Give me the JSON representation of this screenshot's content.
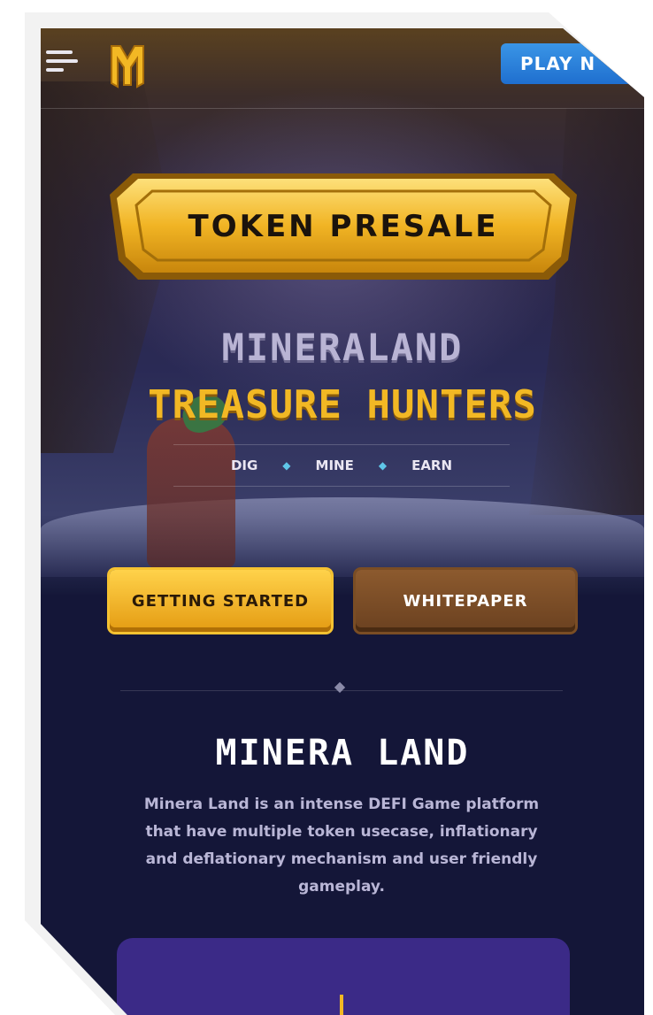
{
  "header": {
    "menu_icon": "hamburger-menu-icon",
    "logo_icon": "m-logo-icon",
    "play_button_label": "PLAY N"
  },
  "hero": {
    "presale_label": "TOKEN PRESALE",
    "title_line1": "MINERALAND",
    "title_line2": "TREASURE HUNTERS",
    "tagline": [
      "DIG",
      "MINE",
      "EARN"
    ],
    "tagline_separator": "◆"
  },
  "actions": {
    "getting_started_label": "GETTING STARTED",
    "whitepaper_label": "WHITEPAPER"
  },
  "about": {
    "title": "MINERA LAND",
    "description": "Minera Land is an intense DEFI Game platform that have multiple token usecase, inflationary and deflationary mechanism and user friendly gameplay."
  },
  "colors": {
    "accent_gold": "#f2b824",
    "play_blue": "#2a86dc",
    "background": "#141638",
    "card_purple": "#3b2a87"
  }
}
